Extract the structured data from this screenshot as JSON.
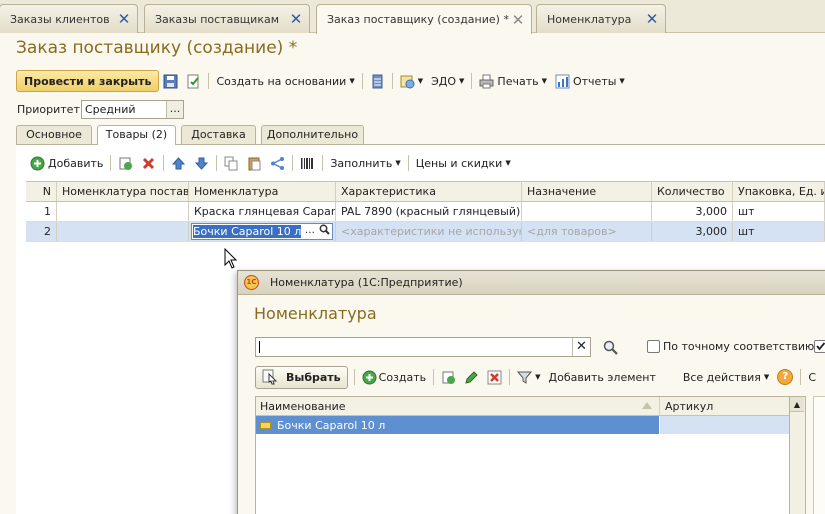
{
  "top_tabs": [
    {
      "label": "Заказы клиентов"
    },
    {
      "label": "Заказы поставщикам"
    },
    {
      "label": "Заказ поставщику (создание) *"
    },
    {
      "label": "Номенклатура"
    }
  ],
  "form": {
    "title": "Заказ поставщику (создание) *",
    "toolbar": {
      "post_close": "Провести и закрыть",
      "create_based": "Создать на основании",
      "edo": "ЭДО",
      "print": "Печать",
      "reports": "Отчеты"
    },
    "priority": {
      "label": "Приоритет:",
      "value": "Средний",
      "dots": "..."
    },
    "tabs": [
      "Основное",
      "Товары (2)",
      "Доставка",
      "Дополнительно"
    ],
    "goods_toolbar": {
      "add": "Добавить",
      "fill": "Заполнить",
      "prices": "Цены и скидки"
    },
    "grid": {
      "columns": [
        "N",
        "Номенклатура постав...",
        "Номенклатура",
        "Характеристика",
        "Назначение",
        "Количество",
        "Упаковка, Ед. и..."
      ],
      "rows": [
        {
          "n": "1",
          "supplier_item": "",
          "item": "Краска глянцевая Caparol",
          "characteristic": "PAL 7890 (красный глянцевый)",
          "purpose": "",
          "qty": "3,000",
          "unit": "шт"
        },
        {
          "n": "2",
          "supplier_item": "",
          "item": "Бочки Caparol 10 л",
          "characteristic": "<характеристики не использую...",
          "purpose": "<для товаров>",
          "qty": "3,000",
          "unit": "шт"
        }
      ]
    }
  },
  "popup": {
    "window_title": "Номенклатура (1С:Предприятие)",
    "logo": "1С",
    "heading": "Номенклатура",
    "search_value": "",
    "exact_match": "По точному соответствию",
    "toolbar": {
      "choose": "Выбрать",
      "create": "Создать",
      "add_element": "Добавить элемент",
      "all_actions": "Все действия",
      "help": "?",
      "cut": "С"
    },
    "grid": {
      "columns": [
        "Наименование",
        "Артикул"
      ],
      "rows": [
        {
          "name": "Бочки Caparol 10 л",
          "article": ""
        }
      ]
    }
  },
  "colors": {
    "accent_title": "#8a6a1e",
    "selection": "#5e8fd0",
    "primary_button": "#f0cf66"
  }
}
